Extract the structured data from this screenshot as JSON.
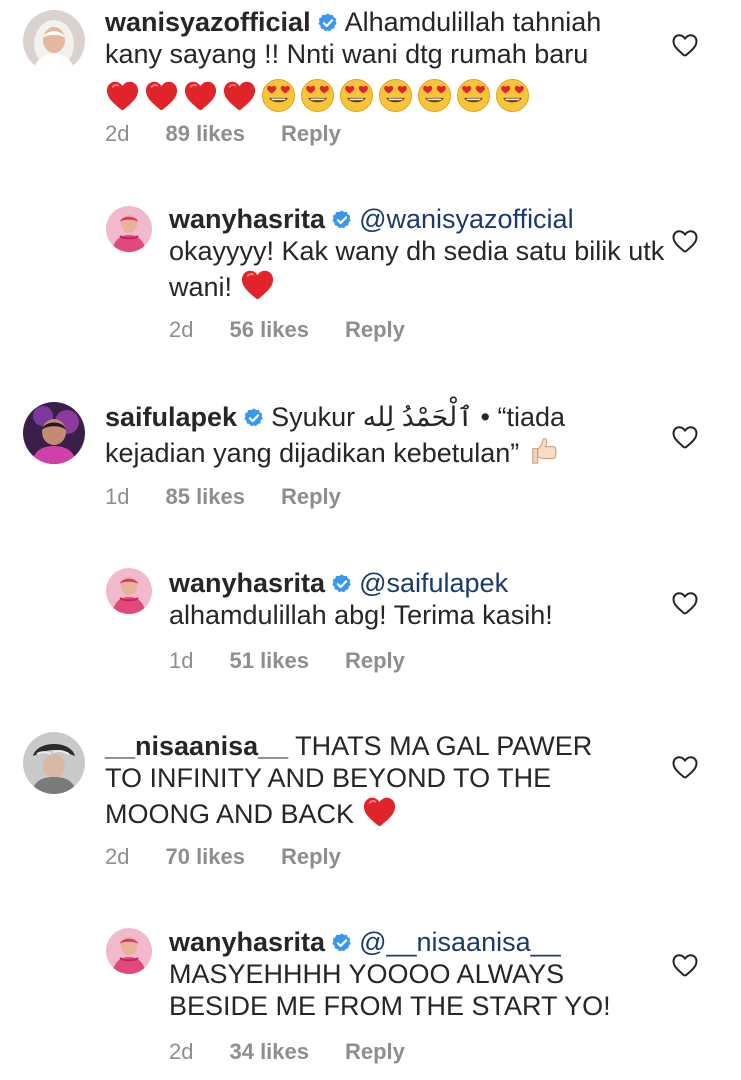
{
  "comments": [
    {
      "username": "wanisyazofficial",
      "mention": "",
      "text": "Alhamdulillah tahniah kany sayang !! Nnti wani dtg rumah baru",
      "time": "2d",
      "likes": "89 likes",
      "reply": "Reply",
      "emojis": [
        "red-heart",
        "red-heart",
        "red-heart",
        "red-heart",
        "heart-eyes",
        "heart-eyes",
        "heart-eyes",
        "heart-eyes",
        "heart-eyes",
        "heart-eyes",
        "heart-eyes"
      ],
      "avatar_color": "#e8e0dc"
    },
    {
      "username": "wanyhasrita",
      "mention": "@wanisyazofficial",
      "text": "okayyyy! Kak wany dh sedia satu bilik utk wani!",
      "time": "2d",
      "likes": "56 likes",
      "reply": "Reply",
      "emojis": [
        "red-heart"
      ],
      "avatar_color": "#e04a7a"
    },
    {
      "username": "saifulapek",
      "mention": "",
      "text_line1": "Syukur ٱلْحَمْدُ لِله • “tiada",
      "text_line2": "kejadian yang dijadikan kebetulan”",
      "time": "1d",
      "likes": "85 likes",
      "reply": "Reply",
      "emojis": [
        "thumbs-up"
      ],
      "avatar_color": "#5b2a6e"
    },
    {
      "username": "wanyhasrita",
      "mention": "@saifulapek",
      "text": "alhamdulillah abg! Terima kasih!",
      "time": "1d",
      "likes": "51 likes",
      "reply": "Reply",
      "emojis": [],
      "avatar_color": "#e04a7a"
    },
    {
      "username": "__nisaanisa__",
      "mention": "",
      "text_line1": "THATS MA GAL PAWER",
      "text_line2": "TO INFINITY AND BEYOND TO THE",
      "text_line3": "MOONG AND BACK",
      "time": "2d",
      "likes": "70 likes",
      "reply": "Reply",
      "emojis": [
        "red-heart"
      ],
      "avatar_color": "#9a9a9a"
    },
    {
      "username": "wanyhasrita",
      "mention": "@__nisaanisa__",
      "text_line1": "MASYEHHHH YOOOO ALWAYS",
      "text_line2": "BESIDE ME FROM THE START YO!",
      "time": "2d",
      "likes": "34 likes",
      "reply": "Reply",
      "emojis": [],
      "avatar_color": "#e04a7a"
    }
  ],
  "colors": {
    "text": "#262626",
    "muted": "#8e8e8e",
    "mention": "#1a3a6b",
    "verified": "#3897f0",
    "heart_red": "#e0242a"
  }
}
